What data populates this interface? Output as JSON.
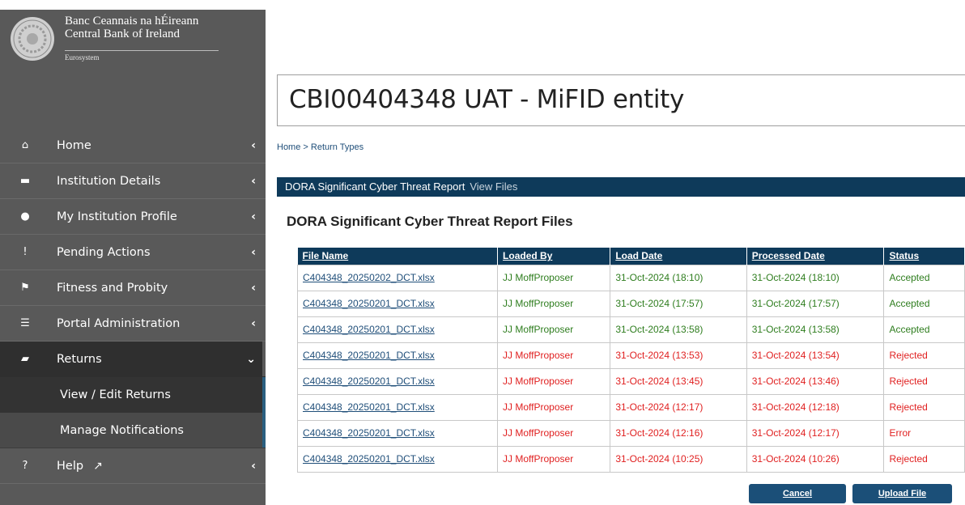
{
  "bank": {
    "name_irish": "Banc Ceannais na hÉireann",
    "name_english": "Central Bank of Ireland",
    "subtitle": "Eurosystem"
  },
  "sidebar": {
    "items": [
      {
        "label": "Home",
        "icon": "home-icon",
        "glyph": "⌂"
      },
      {
        "label": "Institution Details",
        "icon": "briefcase-icon",
        "glyph": "▬"
      },
      {
        "label": "My Institution Profile",
        "icon": "user-icon",
        "glyph": "●"
      },
      {
        "label": "Pending Actions",
        "icon": "alert-icon",
        "glyph": "!"
      },
      {
        "label": "Fitness and Probity",
        "icon": "flag-icon",
        "glyph": "⚑"
      },
      {
        "label": "Portal Administration",
        "icon": "list-icon",
        "glyph": "☰"
      },
      {
        "label": "Returns",
        "icon": "folder-open-icon",
        "glyph": "▰"
      }
    ],
    "returns_subitems": [
      {
        "label": "View / Edit Returns"
      },
      {
        "label": "Manage Notifications"
      }
    ],
    "help": {
      "label": "Help",
      "icon": "question-icon",
      "glyph": "?",
      "ext_glyph": "↗"
    },
    "chevron_left": "‹",
    "chevron_down": "⌄"
  },
  "page": {
    "title": "CBI00404348 UAT - MiFID entity",
    "breadcrumb": {
      "home": "Home",
      "separator": " > ",
      "current": "Return Types"
    },
    "banner": {
      "section": "DORA Significant Cyber Threat Report",
      "view": "View Files"
    },
    "files_title": "DORA Significant Cyber Threat Report Files"
  },
  "table": {
    "headers": [
      "File Name",
      "Loaded By",
      "Load Date",
      "Processed Date",
      "Status"
    ],
    "rows": [
      {
        "file": "C404348_20250202_DCT.xlsx",
        "by": "JJ MoffProposer",
        "load": "31-Oct-2024 (18:10)",
        "processed": "31-Oct-2024 (18:10)",
        "status": "Accepted"
      },
      {
        "file": "C404348_20250201_DCT.xlsx",
        "by": "JJ MoffProposer",
        "load": "31-Oct-2024 (17:57)",
        "processed": "31-Oct-2024 (17:57)",
        "status": "Accepted"
      },
      {
        "file": "C404348_20250201_DCT.xlsx",
        "by": "JJ MoffProposer",
        "load": "31-Oct-2024 (13:58)",
        "processed": "31-Oct-2024 (13:58)",
        "status": "Accepted"
      },
      {
        "file": "C404348_20250201_DCT.xlsx",
        "by": "JJ MoffProposer",
        "load": "31-Oct-2024 (13:53)",
        "processed": "31-Oct-2024 (13:54)",
        "status": "Rejected"
      },
      {
        "file": "C404348_20250201_DCT.xlsx",
        "by": "JJ MoffProposer",
        "load": "31-Oct-2024 (13:45)",
        "processed": "31-Oct-2024 (13:46)",
        "status": "Rejected"
      },
      {
        "file": "C404348_20250201_DCT.xlsx",
        "by": "JJ MoffProposer",
        "load": "31-Oct-2024 (12:17)",
        "processed": "31-Oct-2024 (12:18)",
        "status": "Rejected"
      },
      {
        "file": "C404348_20250201_DCT.xlsx",
        "by": "JJ MoffProposer",
        "load": "31-Oct-2024 (12:16)",
        "processed": "31-Oct-2024 (12:17)",
        "status": "Error"
      },
      {
        "file": "C404348_20250201_DCT.xlsx",
        "by": "JJ MoffProposer",
        "load": "31-Oct-2024 (10:25)",
        "processed": "31-Oct-2024 (10:26)",
        "status": "Rejected"
      }
    ]
  },
  "buttons": {
    "cancel": "Cancel",
    "upload": "Upload File"
  },
  "colors": {
    "navy": "#0e3a5a",
    "sidebar": "#595959",
    "accepted": "#2e7d1e",
    "rejected": "#e02020"
  }
}
